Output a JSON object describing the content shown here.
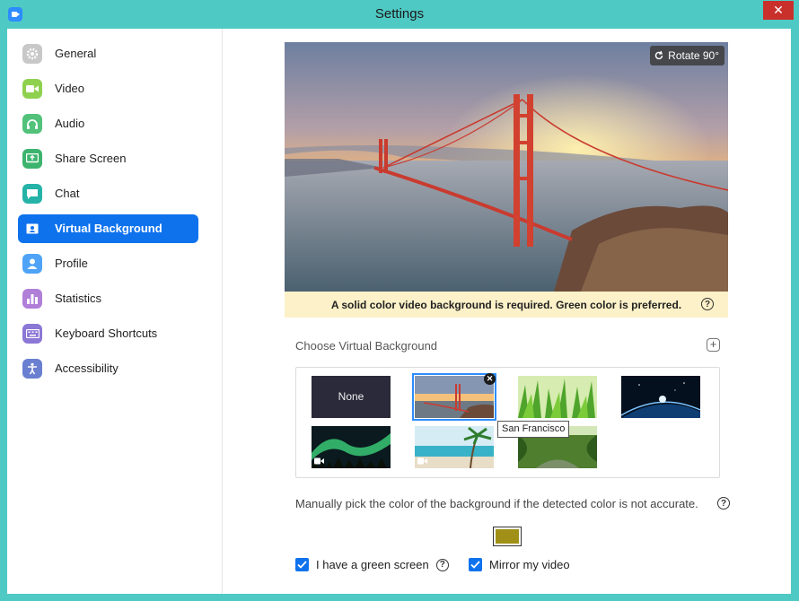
{
  "window": {
    "title": "Settings",
    "close_glyph": "✕"
  },
  "sidebar": {
    "items": [
      {
        "label": "General",
        "icon": "gear-icon",
        "color": "#b9b9b9"
      },
      {
        "label": "Video",
        "icon": "video-icon",
        "color": "#8fd14f"
      },
      {
        "label": "Audio",
        "icon": "headphones-icon",
        "color": "#52c27b"
      },
      {
        "label": "Share Screen",
        "icon": "share-screen-icon",
        "color": "#3cb46e"
      },
      {
        "label": "Chat",
        "icon": "chat-icon",
        "color": "#25b3a8"
      },
      {
        "label": "Virtual Background",
        "icon": "virtual-background-icon",
        "color": "#0e72ed",
        "active": true
      },
      {
        "label": "Profile",
        "icon": "profile-icon",
        "color": "#4fa3f7"
      },
      {
        "label": "Statistics",
        "icon": "statistics-icon",
        "color": "#b07fd8"
      },
      {
        "label": "Keyboard Shortcuts",
        "icon": "keyboard-icon",
        "color": "#8b77d6"
      },
      {
        "label": "Accessibility",
        "icon": "accessibility-icon",
        "color": "#6a7fd0"
      }
    ]
  },
  "preview": {
    "rotate_label": "Rotate 90°",
    "warning": "A solid color video background is required. Green color is preferred."
  },
  "gallery": {
    "label": "Choose Virtual Background",
    "add_glyph": "+",
    "none_label": "None",
    "tooltip": "San Francisco",
    "remove_glyph": "✕"
  },
  "manual": {
    "text": "Manually pick the color of the background if the detected color is not accurate.",
    "swatch_color": "#a09017"
  },
  "options": {
    "green_screen_label": "I have a green screen",
    "mirror_label": "Mirror my video"
  },
  "colors": {
    "accent": "#0e72ed",
    "warning_bg": "#fcf1c8",
    "frame": "#4fc9c4"
  }
}
